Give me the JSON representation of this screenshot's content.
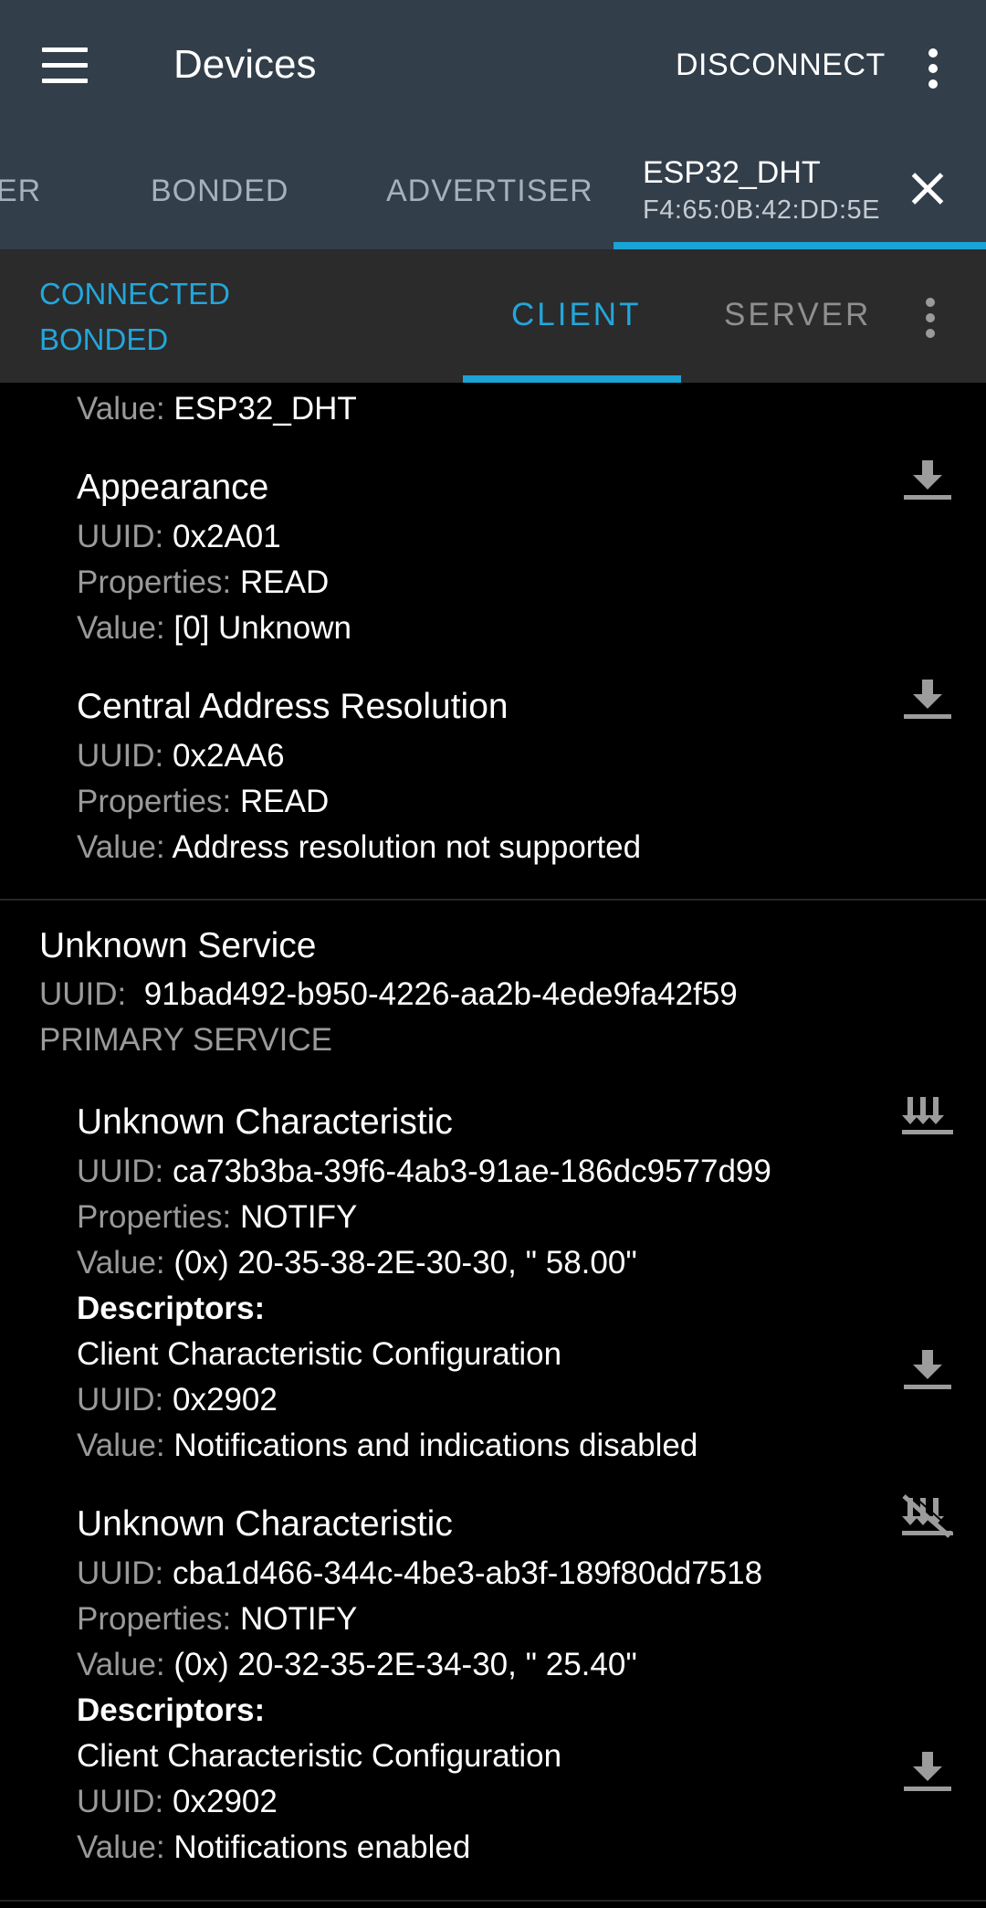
{
  "appbar": {
    "title": "Devices",
    "disconnect": "DISCONNECT"
  },
  "tabs": {
    "partial": "ER",
    "bonded": "BONDED",
    "advertiser": "ADVERTISER",
    "device_name": "ESP32_DHT",
    "device_mac": "F4:65:0B:42:DD:5E"
  },
  "status": {
    "connected": "CONNECTED",
    "bonded": "BONDED"
  },
  "subtabs": {
    "client": "CLIENT",
    "server": "SERVER"
  },
  "labels": {
    "uuid": "UUID:",
    "properties": "Properties:",
    "value": "Value:",
    "descriptors": "Descriptors:"
  },
  "content": {
    "prev_value": "ESP32_DHT",
    "appearance": {
      "name": "Appearance",
      "uuid": "0x2A01",
      "properties": "READ",
      "value": "[0] Unknown",
      "action_icon": "download-icon"
    },
    "car": {
      "name": "Central Address Resolution",
      "uuid": "0x2AA6",
      "properties": "READ",
      "value": "Address resolution not supported",
      "action_icon": "download-icon"
    },
    "service": {
      "name": "Unknown Service",
      "uuid": "91bad492-b950-4226-aa2b-4ede9fa42f59",
      "type": "PRIMARY SERVICE"
    },
    "char1": {
      "name": "Unknown Characteristic",
      "uuid": "ca73b3ba-39f6-4ab3-91ae-186dc9577d99",
      "properties": "NOTIFY",
      "value": "(0x) 20-35-38-2E-30-30, \" 58.00\"",
      "action_icon": "notify-enable-icon",
      "descriptor": {
        "name": "Client Characteristic Configuration",
        "uuid": "0x2902",
        "value": "Notifications and indications disabled",
        "action_icon": "download-icon"
      }
    },
    "char2": {
      "name": "Unknown Characteristic",
      "uuid": "cba1d466-344c-4be3-ab3f-189f80dd7518",
      "properties": "NOTIFY",
      "value": "(0x) 20-32-35-2E-34-30, \" 25.40\"",
      "action_icon": "notify-disable-icon",
      "descriptor": {
        "name": "Client Characteristic Configuration",
        "uuid": "0x2902",
        "value": "Notifications enabled",
        "action_icon": "download-icon"
      }
    }
  },
  "colors": {
    "appbar": "#323e4a",
    "accent": "#1ba3d6",
    "subbar": "#2b2b2b"
  }
}
